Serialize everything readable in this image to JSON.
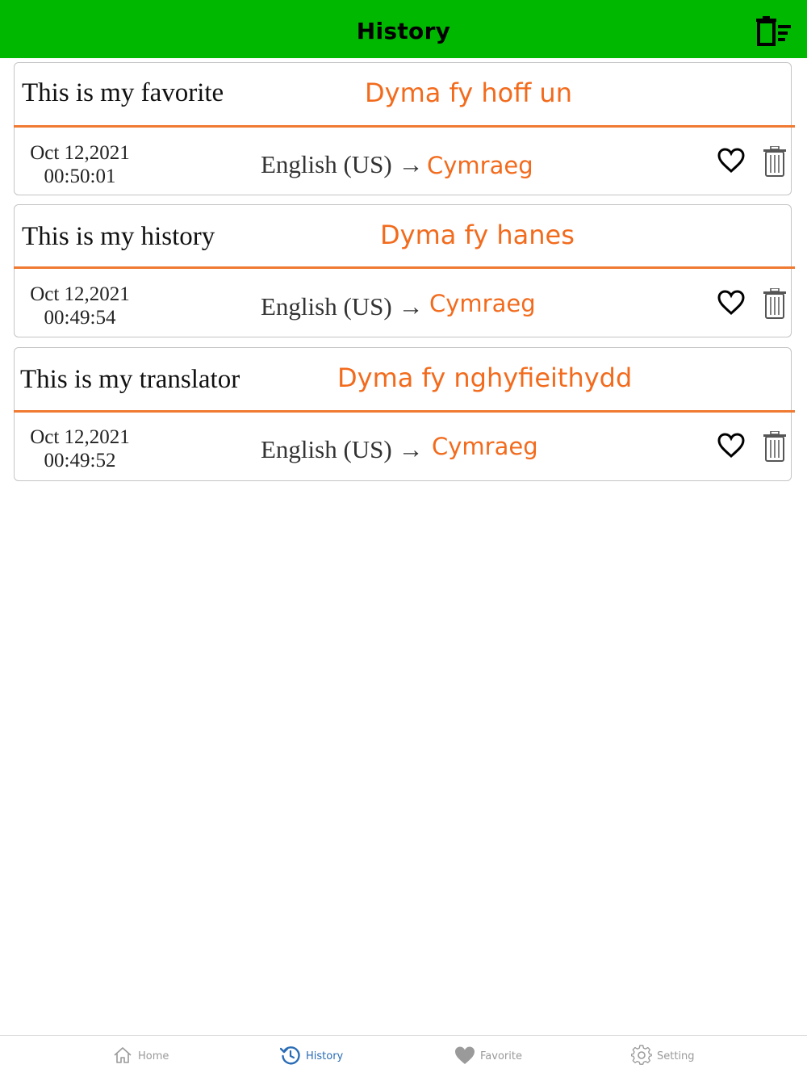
{
  "header": {
    "title": "History",
    "clear_icon": "clear-all-icon"
  },
  "history": [
    {
      "source_text": "This is my favorite",
      "translated_text": "Dyma fy hoff un",
      "date": "Oct 12,2021",
      "time": "00:50:01",
      "language_pair": "English (US) →",
      "target_language": "Cymraeg"
    },
    {
      "source_text": "This is my history",
      "translated_text": "Dyma fy hanes",
      "date": "Oct 12,2021",
      "time": "00:49:54",
      "language_pair": "English (US) →",
      "target_language": "Cymraeg"
    },
    {
      "source_text": "This is my translator",
      "translated_text": "Dyma fy nghyfieithydd",
      "date": "Oct 12,2021",
      "time": "00:49:52",
      "language_pair": "English (US) →",
      "target_language": "Cymraeg"
    }
  ],
  "tabs": [
    {
      "label": "Home",
      "icon": "home-icon",
      "active": false
    },
    {
      "label": "History",
      "icon": "history-icon",
      "active": true
    },
    {
      "label": "Favorite",
      "icon": "heart-icon",
      "active": false
    },
    {
      "label": "Setting",
      "icon": "gear-icon",
      "active": false
    }
  ],
  "colors": {
    "header_bg": "#00b800",
    "accent": "#f26b1d",
    "active_tab": "#2a6db5",
    "inactive_tab": "#9a9a9a"
  }
}
